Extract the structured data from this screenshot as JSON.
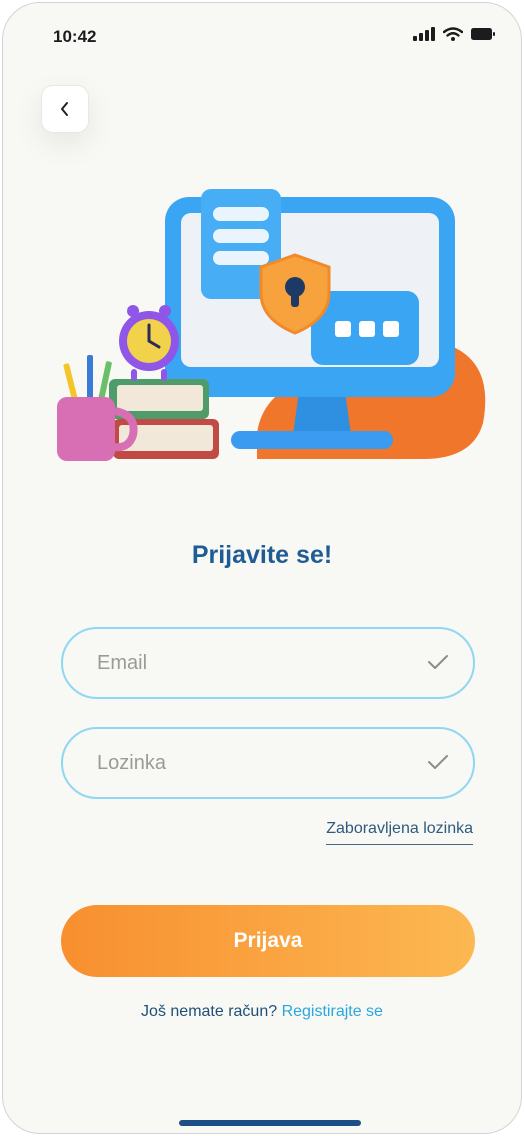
{
  "status_bar": {
    "time": "10:42",
    "icons": [
      "signal-icon",
      "wifi-icon",
      "battery-icon"
    ]
  },
  "back_button": {
    "icon": "chevron-left-icon"
  },
  "illustration": {
    "description_icon": "computer-security-illustration"
  },
  "title": "Prijavite se!",
  "form": {
    "email": {
      "placeholder": "Email",
      "value": "",
      "icon": "check-icon"
    },
    "password": {
      "placeholder": "Lozinka",
      "value": "",
      "icon": "check-icon"
    },
    "forgot_label": "Zaboravljena lozinka",
    "submit_label": "Prijava"
  },
  "register": {
    "question": "Još nemate račun?",
    "link_label": "Registirajte se"
  },
  "colors": {
    "title": "#1f5c95",
    "accent_start": "#f88f2f",
    "accent_end": "#fcb852",
    "field_border": "#8fd7f2",
    "link": "#29a8df"
  }
}
